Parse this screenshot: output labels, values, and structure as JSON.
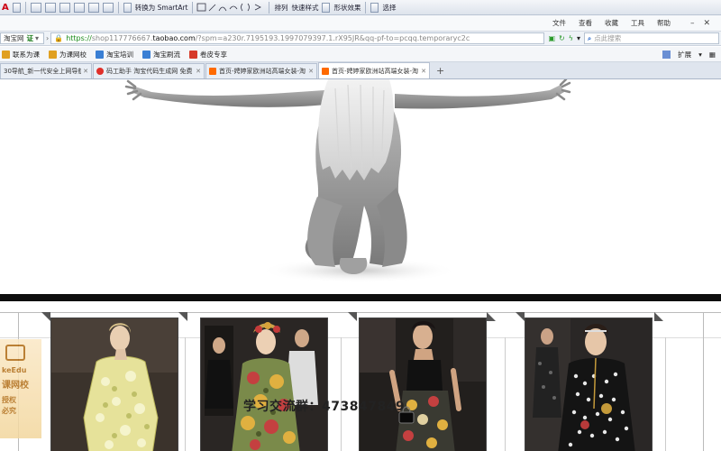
{
  "ribbon": {
    "font_a": "A",
    "smartart_label": "转换为 SmartArt",
    "arrange_label": "排列",
    "quick_style_label": "快速样式",
    "shape_effect_label": "形状效果",
    "select_label": "选择"
  },
  "top_menu": {
    "items": [
      "文件",
      "查看",
      "收藏",
      "工具",
      "帮助"
    ]
  },
  "address_bar": {
    "site_badge": "淘宝网",
    "cert": "证",
    "url_scheme": "https://",
    "url_host_prefix": "shop117776667.",
    "url_host": "taobao.com",
    "url_rest": "/?spm=a230r.7195193.1997079397.1.rX95JR&qq-pf-to=pcqq.temporaryc2c",
    "search_placeholder": "点此搜索"
  },
  "bookmarks": {
    "items": [
      {
        "label": "联系为课",
        "color": "#e0a020"
      },
      {
        "label": "为课网校",
        "color": "#e0a020"
      },
      {
        "label": "淘宝培训",
        "color": "#3a7fd4"
      },
      {
        "label": "淘宝刷流",
        "color": "#3a7fd4"
      },
      {
        "label": "卷皮专享",
        "color": "#d63a2a"
      }
    ],
    "extensions_label": "扩展",
    "grid_label": "▦"
  },
  "tabs": [
    {
      "title": "30导航_新一代安全上网导航",
      "active": false,
      "color": "#3a9ad9"
    },
    {
      "title": "码工助手 淘宝代码生成网 免费",
      "active": false,
      "color": "#e0302a"
    },
    {
      "title": "首页-娉婷家欧洲站高端女装-淘",
      "active": false,
      "color": "#ff6a00"
    },
    {
      "title": "首页-娉婷家欧洲站高端女装-淘",
      "active": true,
      "color": "#ff6a00"
    }
  ],
  "content": {
    "qq_group_text": "学习交流群：473847849",
    "watermark": {
      "line1": "keEdu",
      "line2": "课网校",
      "line3": "授权",
      "line4": "必究"
    }
  }
}
